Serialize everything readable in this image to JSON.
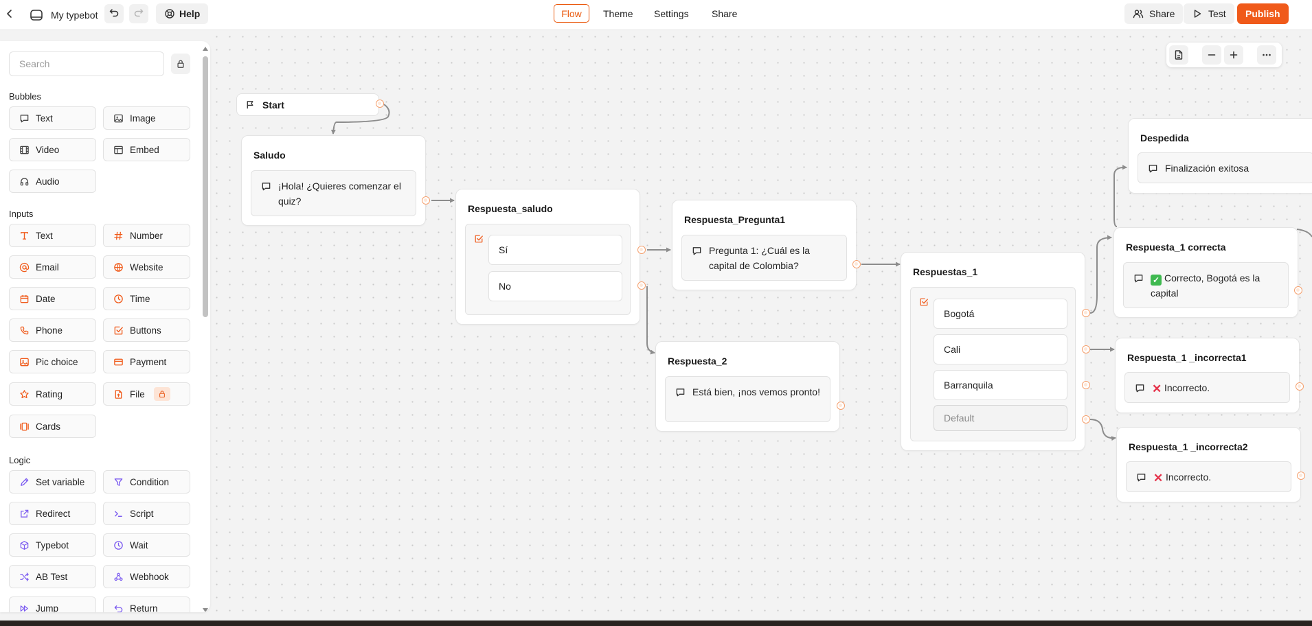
{
  "topbar": {
    "typebot_name": "My typebot",
    "help_label": "Help",
    "tabs": [
      "Flow",
      "Theme",
      "Settings",
      "Share"
    ],
    "share_label": "Share",
    "test_label": "Test",
    "publish_label": "Publish"
  },
  "sidebar": {
    "search_placeholder": "Search",
    "bubbles_heading": "Bubbles",
    "bubbles": [
      "Text",
      "Image",
      "Video",
      "Embed",
      "Audio"
    ],
    "inputs_heading": "Inputs",
    "inputs": [
      "Text",
      "Number",
      "Email",
      "Website",
      "Date",
      "Time",
      "Phone",
      "Buttons",
      "Pic choice",
      "Payment",
      "Rating",
      "File",
      "Cards"
    ],
    "logic_heading": "Logic",
    "logic": [
      "Set variable",
      "Condition",
      "Redirect",
      "Script",
      "Typebot",
      "Wait",
      "AB Test",
      "Webhook",
      "Jump",
      "Return"
    ]
  },
  "canvas": {
    "start_label": "Start",
    "groups": {
      "saludo": {
        "title": "Saludo",
        "text": "¡Hola! ¿Quieres comenzar el quiz?"
      },
      "respuesta_saludo": {
        "title": "Respuesta_saludo",
        "choices": [
          "Sí",
          "No"
        ]
      },
      "respuesta_pregunta1": {
        "title": "Respuesta_Pregunta1",
        "text": "Pregunta 1: ¿Cuál es la capital de Colombia?"
      },
      "respuesta_2": {
        "title": "Respuesta_2",
        "text": "Está bien, ¡nos vemos pronto!"
      },
      "respuestas_1": {
        "title": "Respuestas_1",
        "choices": [
          "Bogotá",
          "Cali",
          "Barranquila"
        ],
        "default_label": "Default"
      },
      "despedida": {
        "title": "Despedida",
        "text": "Finalización exitosa"
      },
      "respuesta_1_correcta": {
        "title": "Respuesta_1 correcta",
        "text": "Correcto, Bogotá es la capital"
      },
      "respuesta_1_incorrecta1": {
        "title": "Respuesta_1 _incorrecta1",
        "text": "Incorrecto."
      },
      "respuesta_1_incorrecta2": {
        "title": "Respuesta_1 _incorrecta2",
        "text": "Incorrecto."
      }
    }
  },
  "colors": {
    "accent": "#f05a1a",
    "logic": "#7c5cf0",
    "port": "#f5a06e"
  }
}
